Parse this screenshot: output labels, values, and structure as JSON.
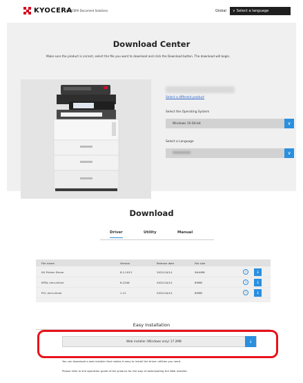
{
  "header": {
    "logo_text": "KYOCERA",
    "logo_subtitle": "KYOCERA Document Solutions",
    "region_label": "Global",
    "language_button_label": "Select a language",
    "brand_color": "#d6001c"
  },
  "download_center": {
    "title": "Download Center",
    "description": "Make sure the product is correct, select the file you want to download and click the Download button. The download will begin.",
    "change_product_link": "Select a different product",
    "os_label": "Select the Operating System",
    "os_selected": "Windows 10 64-bit",
    "language_label": "Select a Language"
  },
  "download": {
    "title": "Download",
    "tabs": [
      {
        "label": "Driver",
        "active": true
      },
      {
        "label": "Utility",
        "active": false
      },
      {
        "label": "Manual",
        "active": false
      }
    ],
    "columns": [
      "File name",
      "Version",
      "Release date",
      "File size"
    ],
    "rows": [
      {
        "name": "KX Printer Driver",
        "version": "8.2.1913",
        "date": "2022/10/14",
        "size": "98.6MB"
      },
      {
        "name": "KPDL mini-driver",
        "version": "8.2206",
        "date": "2022/10/14",
        "size": "89MB"
      },
      {
        "name": "PCL mini-driver",
        "version": "1.11",
        "date": "2022/10/14",
        "size": "89MB"
      }
    ],
    "icons": {
      "info": "info-icon",
      "download": "download-icon"
    },
    "accent_color": "#2a8fdf"
  },
  "easy_installation": {
    "title": "Easy Installation",
    "installer_label": "Web installer (Windows only) 17.2MB",
    "note1": "You can download a web installer that makes it easy to install the driver utilities you need.",
    "note2": "Please refer to the operation guide of the product for the way of downloading the Web installer.",
    "highlight_color": "#e8111b"
  }
}
